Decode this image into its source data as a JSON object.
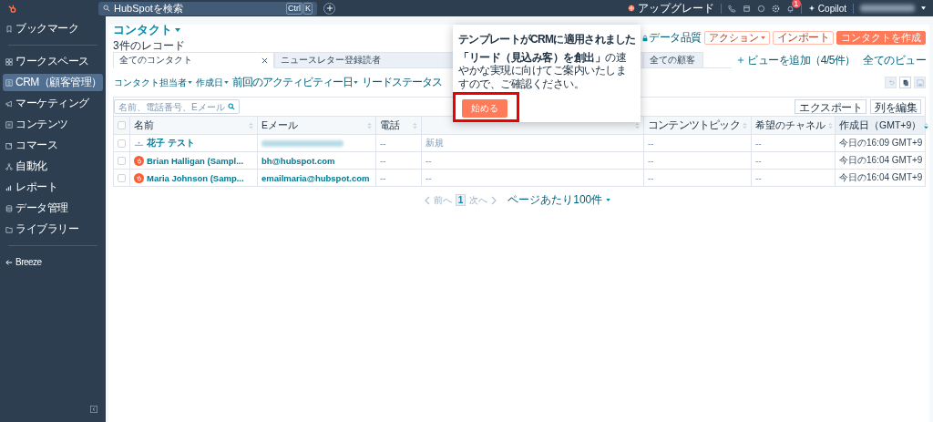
{
  "topbar": {
    "search": {
      "placeholder": "HubSpotを検索",
      "shortcut": [
        "Ctrl",
        "K"
      ]
    },
    "upgrade": "アップグレード",
    "notification_badge": "1",
    "copilot": "Copilot"
  },
  "sidebar": {
    "items": [
      {
        "label": "ブックマーク",
        "selected": false
      },
      {
        "label": "ワークスペース",
        "selected": false
      },
      {
        "label": "CRM（顧客管理）",
        "selected": true
      },
      {
        "label": "マーケティング",
        "selected": false
      },
      {
        "label": "コンテンツ",
        "selected": false
      },
      {
        "label": "コマース",
        "selected": false
      },
      {
        "label": "自動化",
        "selected": false
      },
      {
        "label": "レポート",
        "selected": false
      },
      {
        "label": "データ管理",
        "selected": false
      },
      {
        "label": "ライブラリー",
        "selected": false
      }
    ],
    "breeze": "Breeze"
  },
  "header": {
    "title": "コンタクト",
    "record_count": "3件のレコード",
    "data_quality": "データ品質",
    "buttons": [
      {
        "label": "アクション",
        "kind": "dropdown"
      },
      {
        "label": "インポート",
        "kind": "outline"
      },
      {
        "label": "コンタクトを作成",
        "kind": "primary"
      }
    ]
  },
  "tabs": [
    {
      "label": "全てのコンタクト",
      "selected": true
    },
    {
      "label": "ニュースレター登録読者",
      "selected": false
    },
    {
      "label": "全ての顧客",
      "selected": false
    }
  ],
  "add_view": "ビューを追加（4/5件）",
  "all_views": "全てのビュー",
  "filters": [
    "コンタクト担当者",
    "作成日",
    "前回のアクティビティー日",
    "リードステータス"
  ],
  "table_search": {
    "placeholder": "名前、電話番号、Eメール"
  },
  "table_buttons": [
    "エクスポート",
    "列を編集"
  ],
  "table": {
    "header_checked": false,
    "columns": [
      {
        "label": "名前",
        "sorted": false
      },
      {
        "label": "Eメール",
        "sorted": false
      },
      {
        "label": "電話",
        "sorted": false
      },
      {
        "sorted": false
      },
      {
        "label": "コンテンツトピック",
        "sorted": false
      },
      {
        "label": "希望のチャネル",
        "sorted": false
      },
      {
        "label": "作成日（GMT+9）",
        "sorted": true
      }
    ],
    "rows": [
      {
        "checked": false,
        "kind": "placeholder",
        "email_hidden": true,
        "cells": [
          "花子 テスト",
          "",
          "--",
          "新規",
          "--",
          "--",
          "今日の16:09 GMT+9"
        ]
      },
      {
        "checked": false,
        "kind": "logo",
        "email_hidden": false,
        "cells": [
          "Brian Halligan (Sampl...",
          "bh@hubspot.com",
          "--",
          "--",
          "--",
          "--",
          "今日の16:04 GMT+9"
        ]
      },
      {
        "checked": false,
        "kind": "logo",
        "email_hidden": false,
        "cells": [
          "Maria Johnson (Samp...",
          "emailmaria@hubspot.com",
          "--",
          "--",
          "--",
          "--",
          "今日の16:04 GMT+9"
        ]
      }
    ]
  },
  "pagination": {
    "prev": "前へ",
    "page": "1",
    "next": "次へ",
    "per_page": "ページあたり100件"
  },
  "modal": {
    "title": "テンプレートがCRMに適用されました",
    "body": "**「リード（見込み客）を創出」**の速やかな実現に向けてご案内いたしますので、ご確認ください。",
    "button": "始める",
    "highlighted": true
  }
}
